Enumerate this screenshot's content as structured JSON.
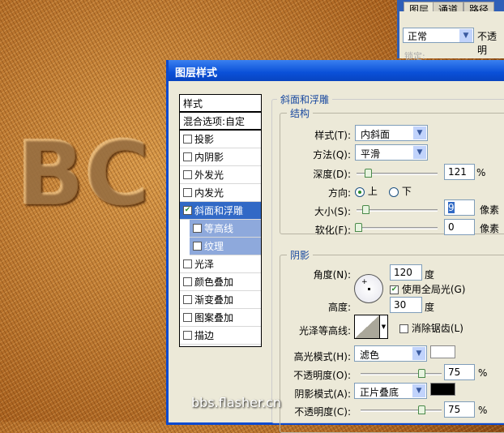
{
  "layers_panel": {
    "tabs": [
      "图层",
      "通道",
      "路径"
    ],
    "blend_mode": "正常",
    "opacity_label": "不透明",
    "lock_label": "锁定:"
  },
  "dialog": {
    "title": "图层样式",
    "styles_list": [
      {
        "label": "样式",
        "type": "header"
      },
      {
        "label": "混合选项:自定",
        "type": "header"
      },
      {
        "label": "投影",
        "checked": false
      },
      {
        "label": "内阴影",
        "checked": false
      },
      {
        "label": "外发光",
        "checked": false
      },
      {
        "label": "内发光",
        "checked": false
      },
      {
        "label": "斜面和浮雕",
        "checked": true,
        "selected": true
      },
      {
        "label": "等高线",
        "checked": false,
        "sub": true
      },
      {
        "label": "纹理",
        "checked": false,
        "sub": true
      },
      {
        "label": "光泽",
        "checked": false
      },
      {
        "label": "颜色叠加",
        "checked": false
      },
      {
        "label": "渐变叠加",
        "checked": false
      },
      {
        "label": "图案叠加",
        "checked": false
      },
      {
        "label": "描边",
        "checked": false
      }
    ],
    "bevel": {
      "title": "斜面和浮雕",
      "structure": {
        "title": "结构",
        "style_label": "样式(T):",
        "style_value": "内斜面",
        "technique_label": "方法(Q):",
        "technique_value": "平滑",
        "depth_label": "深度(D):",
        "depth_value": "121",
        "depth_unit": "%",
        "direction_label": "方向:",
        "direction_up": "上",
        "direction_down": "下",
        "direction_selected": "上",
        "size_label": "大小(S):",
        "size_value": "9",
        "size_unit": "像素",
        "soften_label": "软化(F):",
        "soften_value": "0",
        "soften_unit": "像素"
      },
      "shading": {
        "title": "阴影",
        "angle_label": "角度(N):",
        "angle_value": "120",
        "angle_unit": "度",
        "global_light_label": "使用全局光(G)",
        "global_light_checked": true,
        "altitude_label": "高度:",
        "altitude_value": "30",
        "altitude_unit": "度",
        "gloss_contour_label": "光泽等高线:",
        "anti_alias_label": "消除锯齿(L)",
        "anti_alias_checked": false,
        "highlight_mode_label": "高光模式(H):",
        "highlight_mode_value": "滤色",
        "highlight_color": "#ffffff",
        "highlight_opacity_label": "不透明度(O):",
        "highlight_opacity_value": "75",
        "highlight_opacity_unit": "%",
        "shadow_mode_label": "阴影模式(A):",
        "shadow_mode_value": "正片叠底",
        "shadow_color": "#000000",
        "shadow_opacity_label": "不透明度(C):",
        "shadow_opacity_value": "75",
        "shadow_opacity_unit": "%"
      }
    }
  },
  "watermark": "bbs.flasher.cn"
}
